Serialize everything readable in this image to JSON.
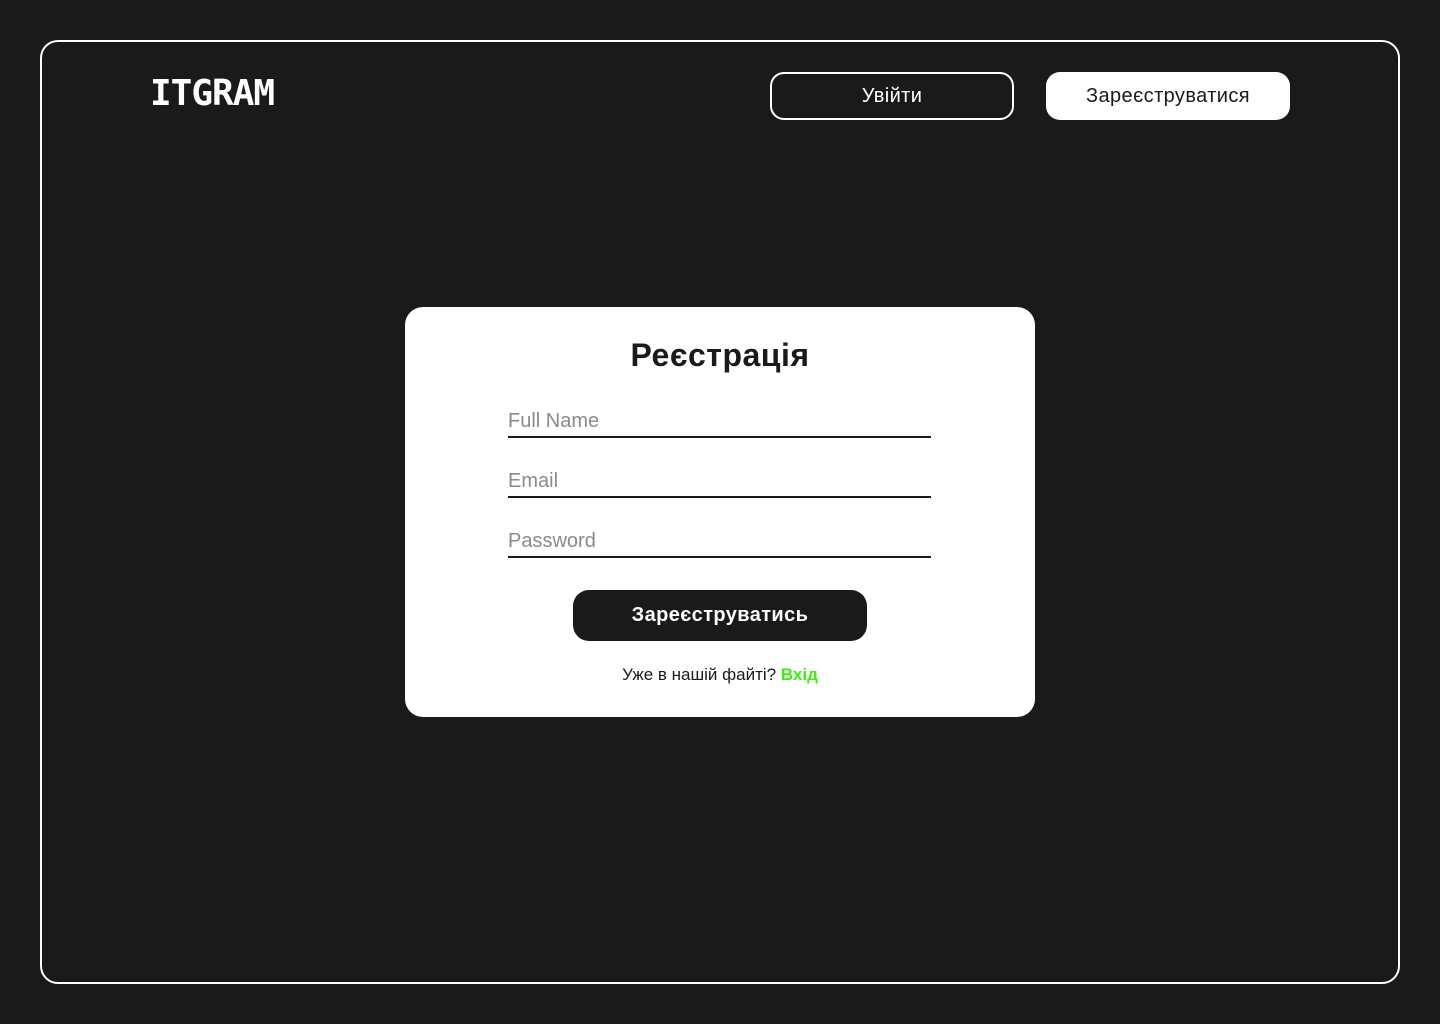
{
  "header": {
    "logo": "ITGRAM",
    "login_label": "Увійти",
    "register_label": "Зареєструватися"
  },
  "form": {
    "title": "Реєстрація",
    "full_name": {
      "placeholder": "Full Name",
      "value": ""
    },
    "email": {
      "placeholder": "Email",
      "value": ""
    },
    "password": {
      "placeholder": "Password",
      "value": ""
    },
    "submit_label": "Зареєструватись",
    "signin_prompt": "Уже в нашій файті?",
    "signin_link": "Вхід"
  },
  "colors": {
    "background": "#1a1a1a",
    "card": "#ffffff",
    "accent": "#3ef012"
  }
}
